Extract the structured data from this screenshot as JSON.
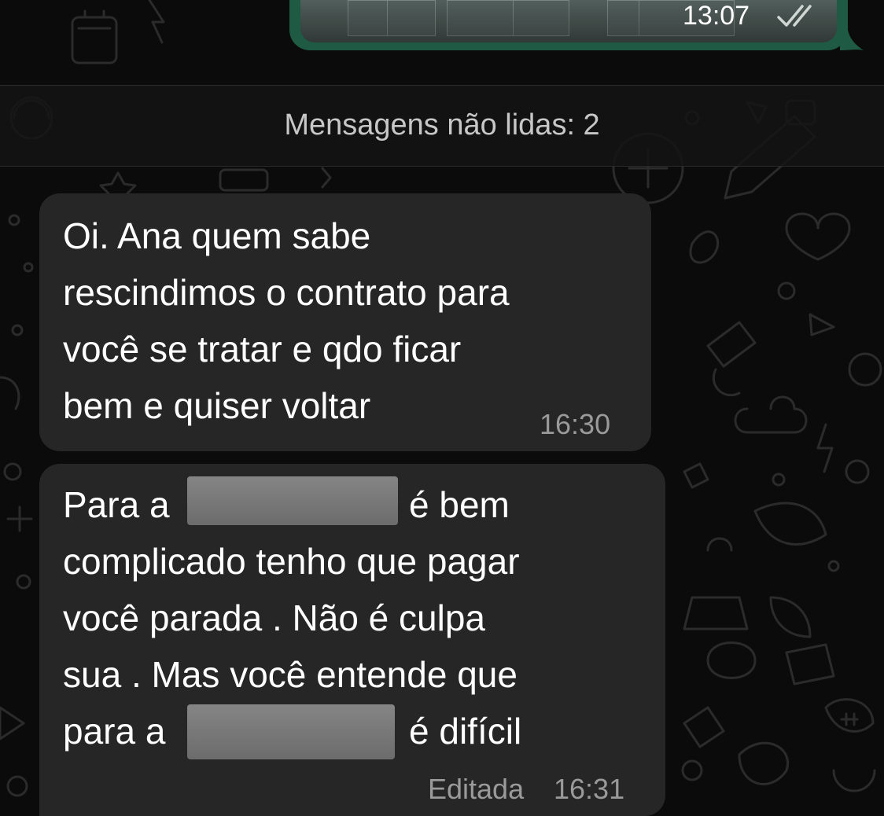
{
  "colors": {
    "wallpaper": "#0b0b0b",
    "incoming_bubble": "#262626",
    "outgoing_bubble": "#1f5b44",
    "meta_text": "#9a9a9a",
    "divider_text": "#c7c7c7"
  },
  "outgoing_message": {
    "type": "image",
    "time": "13:07",
    "status_icon": "double-check-read-icon"
  },
  "unread_divider": {
    "label": "Mensagens não lidas: 2"
  },
  "messages": [
    {
      "lines": [
        "Oi. Ana quem sabe",
        "rescindimos o contrato para",
        "você se tratar e qdo ficar",
        "bem e quiser voltar"
      ],
      "time": "16:30"
    },
    {
      "lines": [
        "Para a",
        "é bem",
        "complicado tenho que pagar",
        "você parada . Não é culpa",
        "sua . Mas você entende que",
        "para a",
        "é difícil"
      ],
      "edited_label": "Editada",
      "time": "16:31"
    }
  ]
}
